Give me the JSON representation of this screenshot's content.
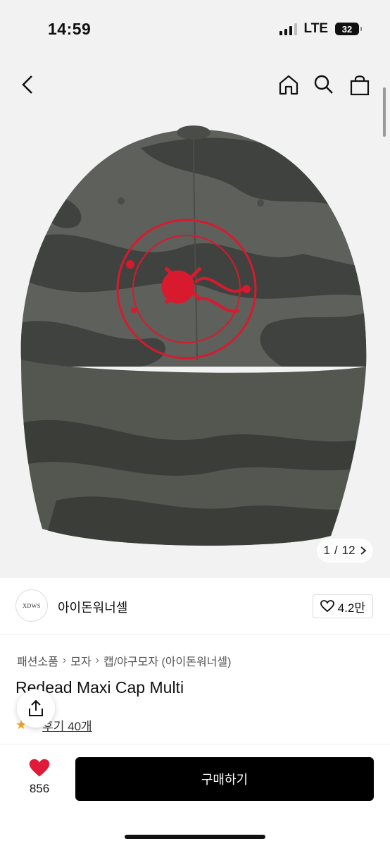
{
  "status": {
    "time": "14:59",
    "network": "LTE",
    "battery": "32"
  },
  "hero": {
    "page_current": "1",
    "page_sep": "/",
    "page_total": "12"
  },
  "seller": {
    "logo_text": "XDWS",
    "name": "아이돈워너셀",
    "likes": "4.2만"
  },
  "breadcrumb": [
    "패션소품",
    "모자",
    "캡/야구모자 (아이돈워너셀)"
  ],
  "product": {
    "title": "Redead Maxi Cap Multi",
    "review_text": "후기 40개"
  },
  "colors": {
    "accent": "#e01b3a",
    "buy_bg": "#000000"
  },
  "bottom": {
    "wish_count": "856",
    "buy_label": "구매하기"
  }
}
